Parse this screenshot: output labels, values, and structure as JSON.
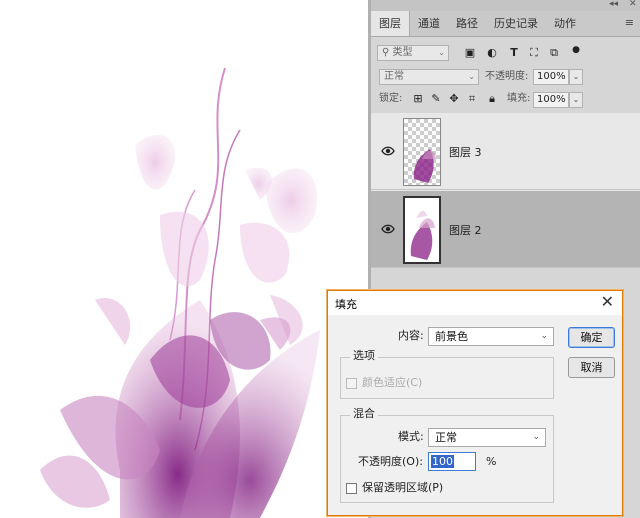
{
  "panel": {
    "tabs": [
      "图层",
      "通道",
      "路径",
      "历史记录",
      "动作"
    ],
    "topbar_collapse": "◂◂",
    "topbar_close": "✕",
    "menu_icon": "≡",
    "filter_label": "类型",
    "blend_mode": "正常",
    "opacity_label": "不透明度:",
    "opacity_value": "100%",
    "lock_label": "锁定:",
    "fill_label": "填充:",
    "fill_value": "100%"
  },
  "layers": [
    {
      "name": "图层 3",
      "visible": true,
      "selected": false
    },
    {
      "name": "图层 2",
      "visible": true,
      "selected": true
    }
  ],
  "dialog": {
    "title": "填充",
    "content_label": "内容:",
    "content_value": "前景色",
    "options_group": "选项",
    "color_adapt_label": "颜色适应(C)",
    "blend_group": "混合",
    "mode_label": "模式:",
    "mode_value": "正常",
    "opacity_label": "不透明度(O):",
    "opacity_value": "100",
    "opacity_unit": "%",
    "preserve_label": "保留透明区域(P)",
    "ok_label": "确定",
    "cancel_label": "取消"
  },
  "colors": {
    "accent_orange": "#e07b00",
    "flower_purple": "#8a1f86",
    "flower_pink": "#d9a0cf"
  }
}
